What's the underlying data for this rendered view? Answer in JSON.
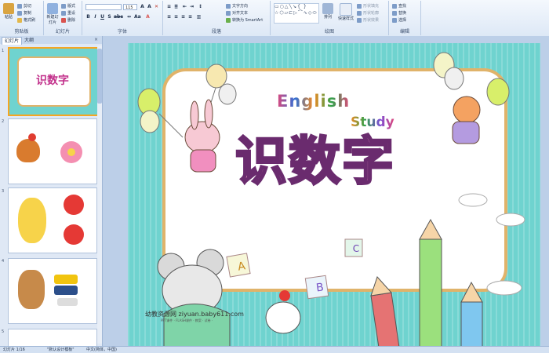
{
  "ribbon": {
    "clipboard": {
      "label": "剪贴板",
      "paste": "粘贴",
      "cut": "剪切",
      "copy": "复制",
      "format_painter": "格式刷"
    },
    "slides": {
      "label": "幻灯片",
      "new_slide": "新建幻灯片",
      "layout": "版式",
      "reset": "重设",
      "delete": "删除"
    },
    "font": {
      "label": "字体",
      "size": "115"
    },
    "paragraph": {
      "label": "段落",
      "text_direction": "文字方向",
      "align_text": "对齐文本",
      "smartart": "转换为 SmartArt"
    },
    "drawing": {
      "label": "绘图",
      "arrange": "排列",
      "quick_styles": "快速样式",
      "fill": "形状填充",
      "outline": "形状轮廓",
      "effects": "形状效果"
    },
    "editing": {
      "label": "编辑",
      "find": "查找",
      "replace": "替换",
      "select": "选择"
    }
  },
  "panel": {
    "tab_slides": "幻灯片",
    "tab_outline": "大纲",
    "numbers": [
      "1",
      "2",
      "3",
      "4",
      "5"
    ]
  },
  "slide": {
    "english": "English",
    "study": "Study",
    "title": "识数字",
    "letter_a": "A",
    "letter_b": "B",
    "letter_c": "C",
    "watermark": "幼教资源网 ziyuan.baby611.com",
    "watermark_sub": "PPT课件 · FLASH课件 · 教案 · 试卷 ·"
  },
  "status": {
    "slide_count": "幻灯片 1/16",
    "theme": "\"默认设计模板\"",
    "language": "中文(简体，中国)"
  }
}
